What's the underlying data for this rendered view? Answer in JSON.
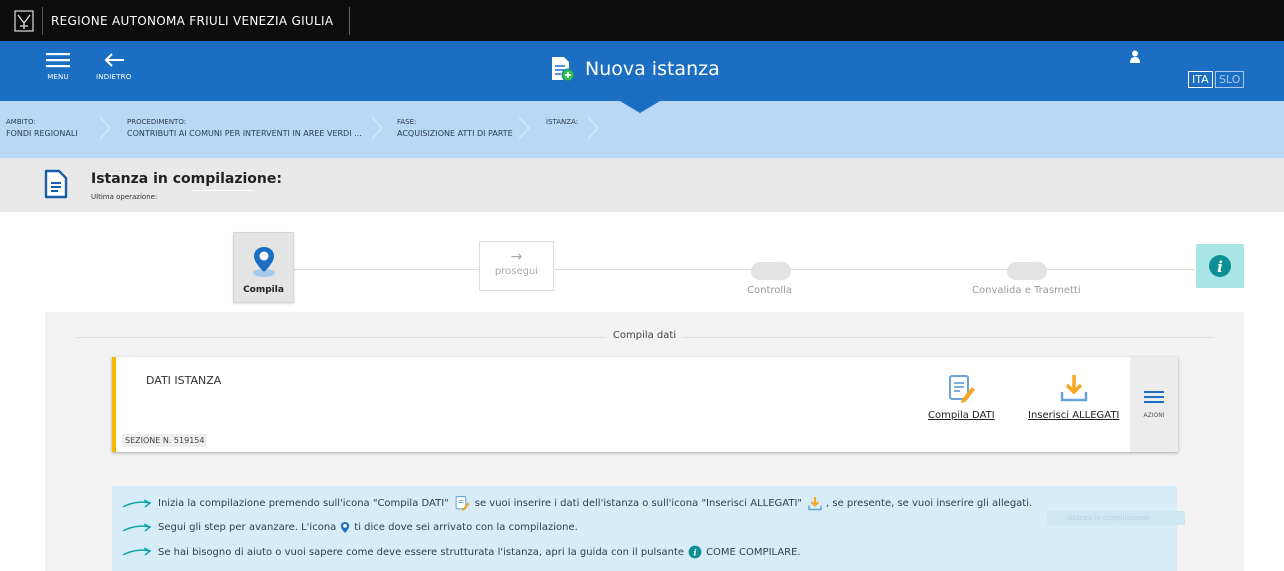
{
  "topbar": {
    "region": "REGIONE AUTONOMA FRIULI VENEZIA GIULIA",
    "logo_icon": "coat-of-arms"
  },
  "header": {
    "menu_label": "MENU",
    "back_label": "INDIETRO",
    "title": "Nuova istanza",
    "title_icon": "new-document-icon",
    "user_icon": "user-icon",
    "languages": [
      "ITA",
      "SLO"
    ],
    "active_language": "ITA",
    "color": "#1b6ec2"
  },
  "breadcrumb": [
    {
      "key": "AMBITO:",
      "value": "FONDI REGIONALI"
    },
    {
      "key": "PROCEDIMENTO:",
      "value": "CONTRIBUTI AI COMUNI PER INTERVENTI IN AREE VERDI ..."
    },
    {
      "key": "FASE:",
      "value": "ACQUISIZIONE ATTI DI PARTE"
    },
    {
      "key": "ISTANZA:",
      "value": ""
    }
  ],
  "instance": {
    "heading": "Istanza in compilazione:",
    "last_op": "Ultima operazione:"
  },
  "stepper": {
    "steps": [
      {
        "label": "Compila",
        "state": "current"
      },
      {
        "label": "prosegui",
        "state": "next"
      },
      {
        "label": "Controlla",
        "state": "todo"
      },
      {
        "label": "Convalida e Trasmetti",
        "state": "todo"
      }
    ],
    "info_icon": "info-icon"
  },
  "panel": {
    "title": "Compila dati",
    "card": {
      "title": "DATI ISTANZA",
      "section": "SEZIONE N. 519154",
      "actions": [
        {
          "label": "Compila DATI",
          "icon": "edit-form-icon"
        },
        {
          "label": "Inserisci ALLEGATI",
          "icon": "download-icon"
        }
      ],
      "azioni_label": "AZIONI",
      "accent": "#f5b800"
    }
  },
  "help": {
    "line1_a": "Inizia la compilazione premendo sull'icona \"Compila DATI\"",
    "line1_b": "se vuoi inserire i dati dell'istanza o sull'icona \"Inserisci ALLEGATI\"",
    "line1_c": ", se presente, se vuoi inserire gli allegati.",
    "line2_a": "Segui gli step per avanzare. L'icona",
    "line2_b": "ti dice dove sei arrivato con la compilazione.",
    "line3_a": "Se hai bisogno di aiuto o vuoi sapere come deve essere strutturata l'istanza, apri la guida con il pulsante",
    "line3_b": "COME COMPILARE.",
    "faint": "Istanza in compilazione"
  }
}
